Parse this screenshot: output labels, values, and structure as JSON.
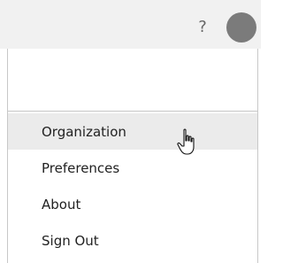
{
  "header": {
    "help_label": "?",
    "avatar_color": "#7b7b7b"
  },
  "menu": {
    "items": [
      {
        "label": "Organization",
        "hovered": true
      },
      {
        "label": "Preferences"
      },
      {
        "label": "About"
      },
      {
        "label": "Sign Out"
      }
    ]
  },
  "cursor": {
    "icon": "hand-pointer-icon"
  }
}
